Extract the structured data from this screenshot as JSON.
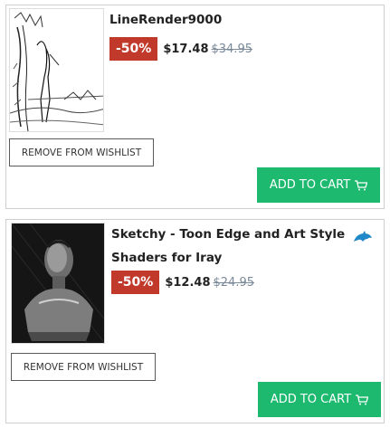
{
  "wishlist": {
    "items": [
      {
        "title": "LineRender9000",
        "discount": "-50%",
        "price": "$17.48",
        "old_price": "$34.95",
        "remove_label": "REMOVE FROM WISHLIST",
        "cart_label": "ADD TO CART",
        "thumbnail_icon": "line-art-figure-thumbnail"
      },
      {
        "title": "Sketchy - Toon Edge and Art Style Shaders for Iray",
        "discount": "-50%",
        "price": "$12.48",
        "old_price": "$24.95",
        "remove_label": "REMOVE FROM WISHLIST",
        "cart_label": "ADD TO CART",
        "thumbnail_icon": "sketch-bust-thumbnail",
        "badge_icon": "dolphin-icon"
      }
    ]
  },
  "colors": {
    "discount_bg": "#c0392b",
    "cart_bg": "#1cb96f",
    "badge": "#1e88c8",
    "old_price": "#7b8a9a"
  }
}
